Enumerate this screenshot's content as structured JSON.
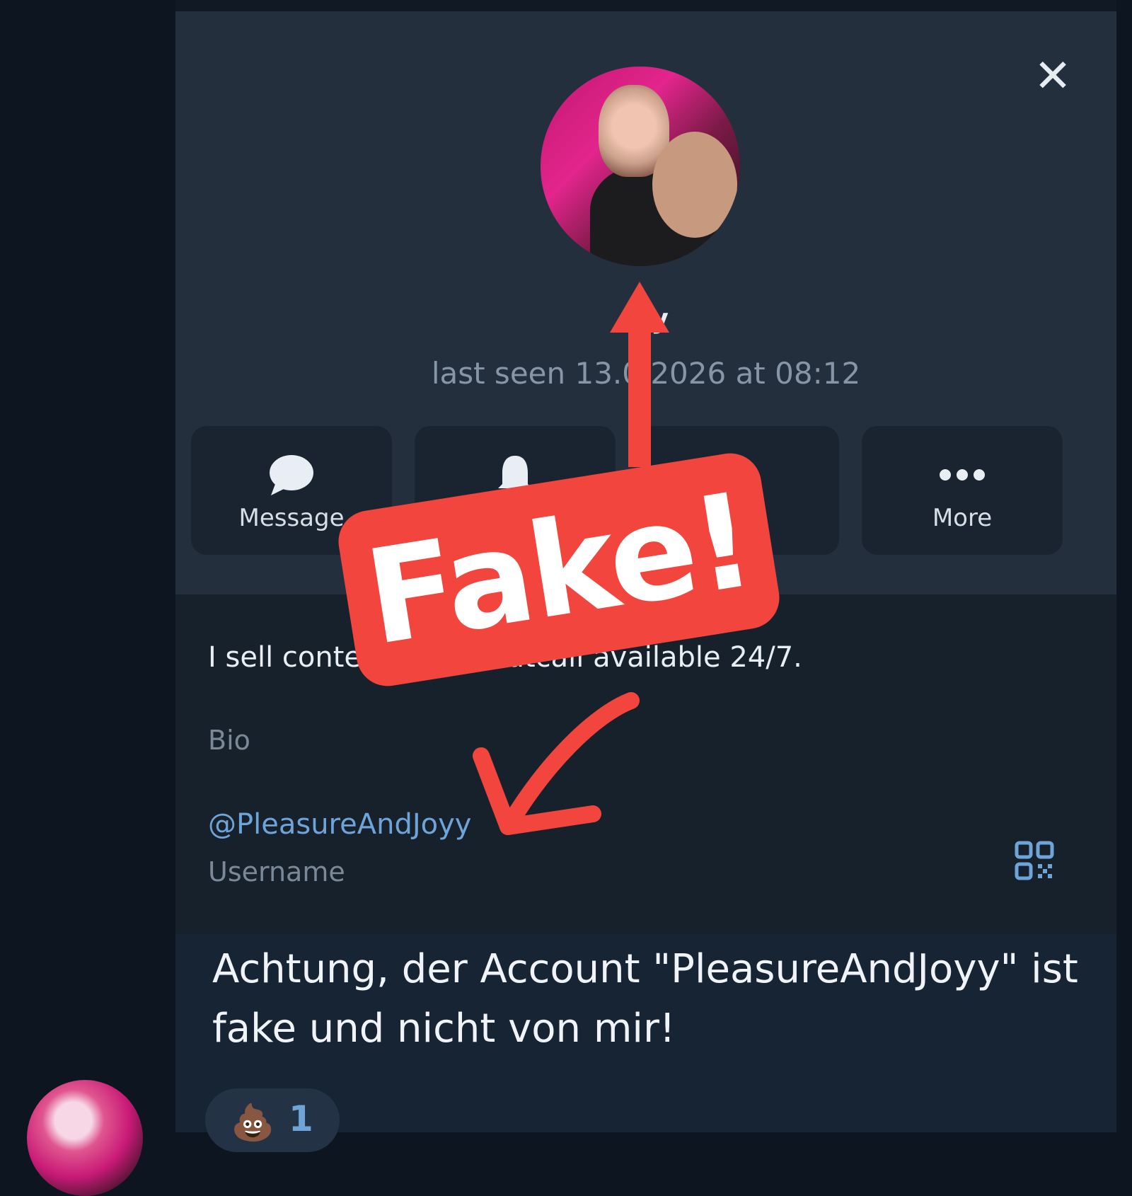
{
  "profile": {
    "name": "Ivy",
    "last_seen": "last seen 13.0  2026 at 08:12",
    "actions": [
      {
        "label": "Message",
        "icon": "message-bubble-icon"
      },
      {
        "label": "",
        "icon": "bell-icon"
      },
      {
        "label": "",
        "icon": "call-icon"
      },
      {
        "label": "More",
        "icon": "more-dots-icon"
      }
    ],
    "bio": "I sell content Incall/Outcall available 24/7.",
    "bio_label": "Bio",
    "username": "@PleasureAndJoyy",
    "username_label": "Username"
  },
  "annotation": {
    "stamp": "Fake!",
    "stamp_color": "#f2453d"
  },
  "message": {
    "text": "Achtung, der Account \"PleasureAndJoyy\" ist fake und nicht von mir!",
    "reaction_emoji": "💩",
    "reaction_count": "1"
  },
  "colors": {
    "accent": "#6ea4d8",
    "panel": "#232f3d",
    "background": "#17212b"
  }
}
